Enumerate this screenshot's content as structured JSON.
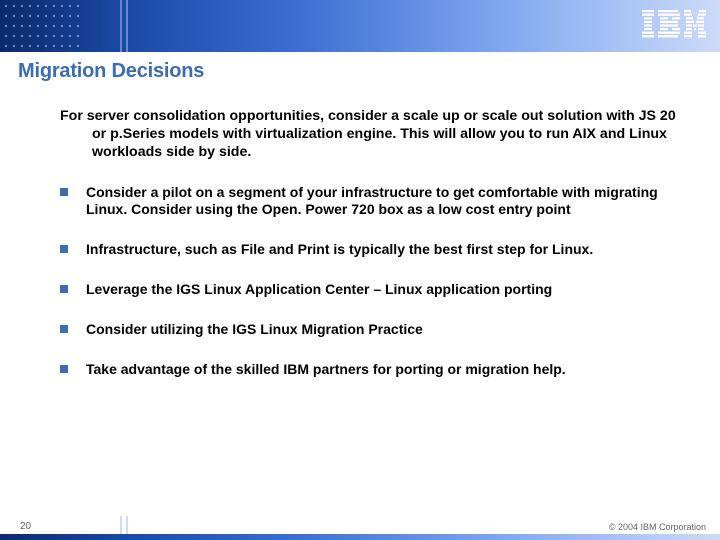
{
  "header": {
    "logo_name": "ibm-logo"
  },
  "title": "Migration Decisions",
  "intro": "For server consolidation opportunities, consider a scale up or scale out solution with JS 20 or p.Series models with virtualization engine.  This will allow you to run AIX and Linux workloads side by side.",
  "bullets": [
    "Consider a pilot on a segment of your infrastructure to get comfortable with migrating Linux. Consider using the Open. Power 720 box as a low cost entry point",
    "Infrastructure, such as File and Print is typically the best first step for Linux.",
    "Leverage the IGS Linux Application Center – Linux application porting",
    "Consider utilizing the IGS Linux Migration Practice",
    "Take advantage of the skilled IBM partners for porting or migration help."
  ],
  "footer": {
    "page": "20",
    "copyright": "© 2004 IBM Corporation"
  }
}
